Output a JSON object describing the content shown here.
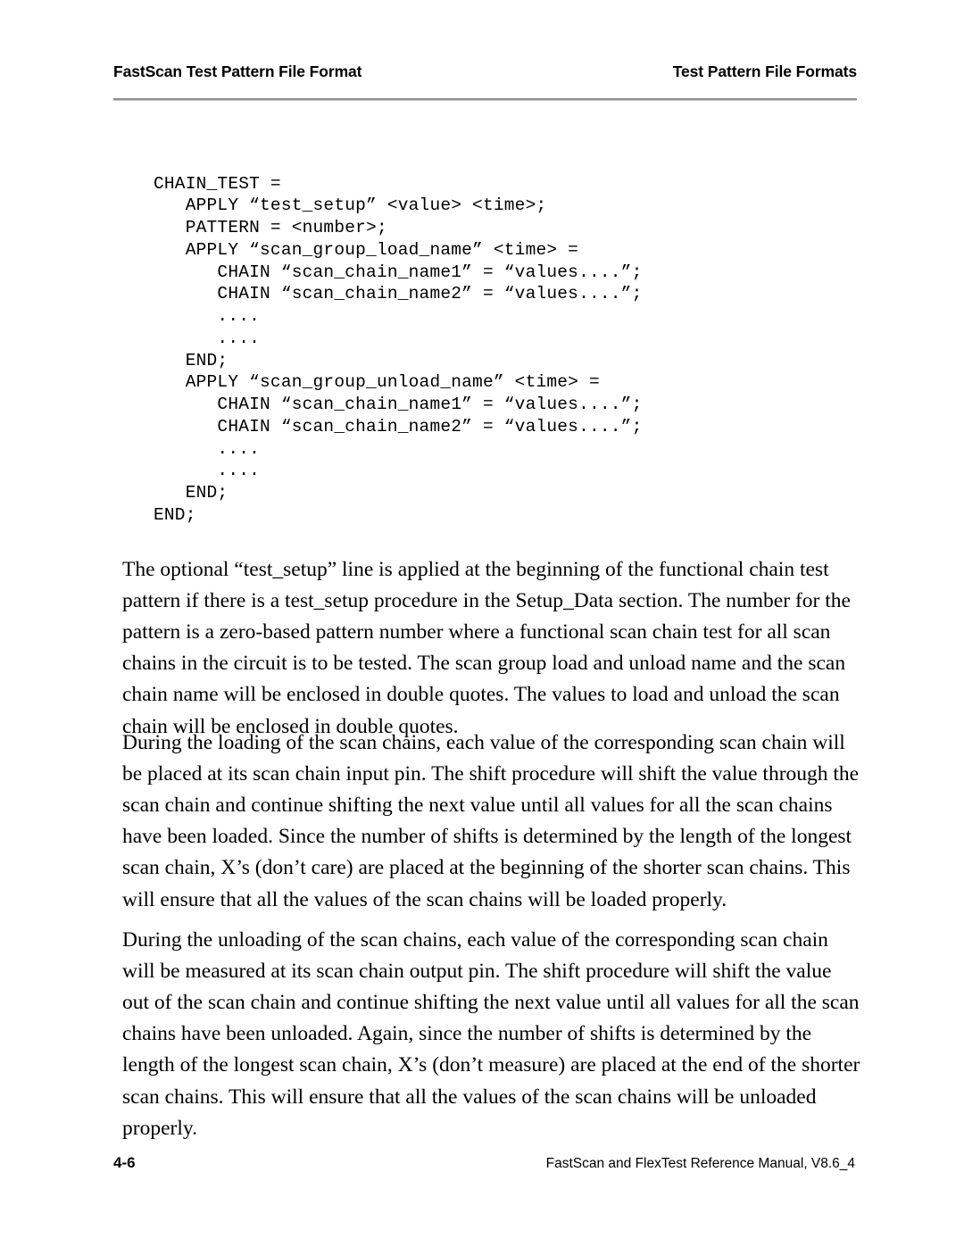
{
  "header": {
    "left_title": "FastScan Test Pattern File Format",
    "right_title": "Test Pattern File Formats"
  },
  "code_block": {
    "language": "test-pattern-file-format",
    "lines": [
      "CHAIN_TEST =",
      "   APPLY “test_setup” <value> <time>;",
      "   PATTERN = <number>;",
      "   APPLY “scan_group_load_name” <time> =",
      "      CHAIN “scan_chain_name1” = “values....”;",
      "      CHAIN “scan_chain_name2” = “values....”;",
      "      ....",
      "      ....",
      "   END;",
      "   APPLY “scan_group_unload_name” <time> =",
      "      CHAIN “scan_chain_name1” = “values....”;",
      "      CHAIN “scan_chain_name2” = “values....”;",
      "      ....",
      "      ....",
      "   END;",
      "END;"
    ]
  },
  "body": {
    "paragraph_1": "The optional “test_setup” line is applied at the beginning of the functional chain test pattern if there is a test_setup procedure in the Setup_Data section. The number for the pattern is a zero-based pattern number where a functional scan chain test for all scan chains in the circuit is to be tested. The scan group load and unload name and the scan chain name will be enclosed in double quotes. The values to load and unload the scan chain will be enclosed in double quotes.",
    "paragraph_2": "During the loading of the scan chains, each value of the corresponding scan chain will be placed at its scan chain input pin. The shift procedure will shift the value through the scan chain and continue shifting the next value until all values for all the scan chains have been loaded. Since the number of shifts is determined by the length of the longest scan chain, X’s (don’t care) are placed at the beginning of the shorter scan chains. This will ensure that all the values of the scan chains will be loaded properly.",
    "paragraph_3": "During the unloading of the scan chains, each value of the corresponding scan chain will be measured at its scan chain output pin. The shift procedure will shift the value out of the scan chain and continue shifting the next value until all values for all the scan chains have been unloaded. Again, since the number of shifts is determined by the length of the longest scan chain, X’s (don’t measure) are placed at the end of the shorter scan chains. This will ensure that all the values of the scan chains will be unloaded properly."
  },
  "footer": {
    "page_number": "4-6",
    "manual": "FastScan and FlexTest Reference Manual, V8.6_4"
  },
  "colors": {
    "text": "#000000",
    "rule": "#8e8e8e",
    "background": "#ffffff"
  }
}
